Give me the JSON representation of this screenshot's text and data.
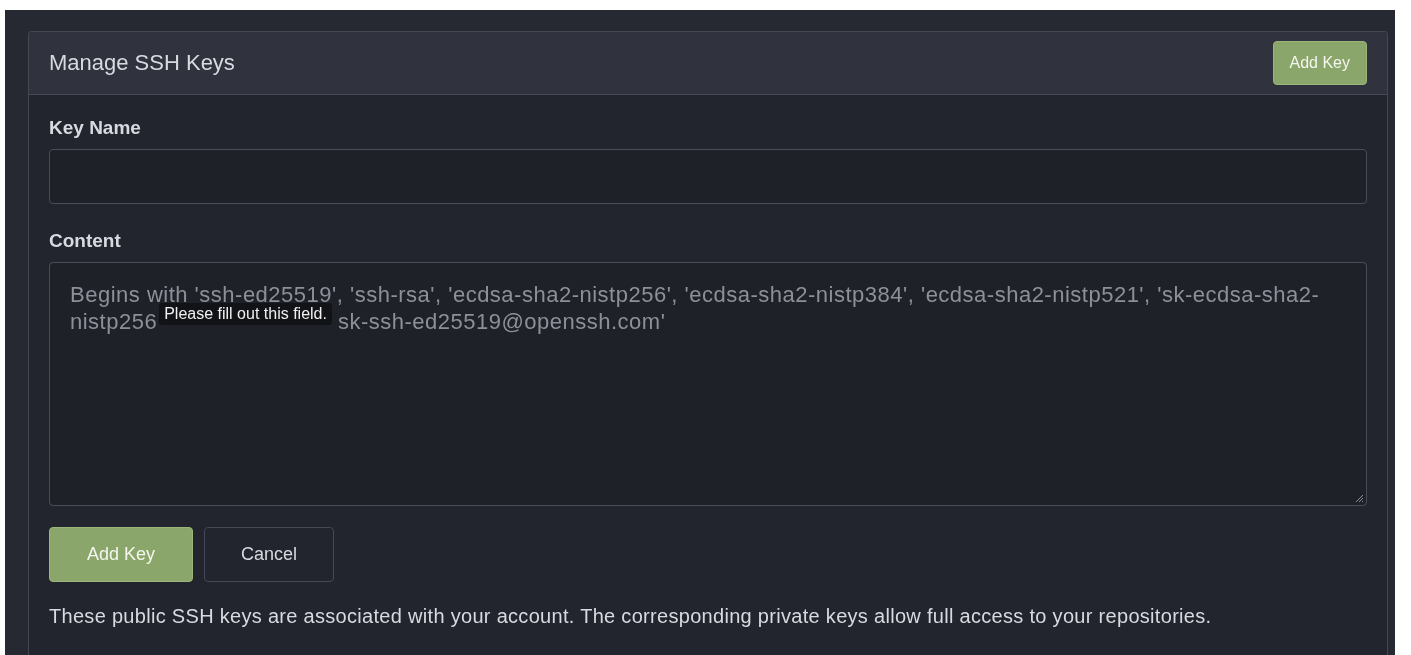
{
  "panel": {
    "title": "Manage SSH Keys",
    "header_button": "Add Key"
  },
  "form": {
    "key_name": {
      "label": "Key Name"
    },
    "content": {
      "label": "Content",
      "placeholder": "Begins with 'ssh-ed25519', 'ssh-rsa', 'ecdsa-sha2-nistp256', 'ecdsa-sha2-nistp384', 'ecdsa-sha2-nistp521', 'sk-ecdsa-sha2-nistp256",
      "placeholder_tail": "sk-ssh-ed25519@openssh.com'"
    },
    "tooltip": "Please fill out this field.",
    "buttons": [
      {
        "label": "Add Key",
        "kind": "primary"
      },
      {
        "label": "Cancel",
        "kind": "secondary"
      }
    ]
  },
  "help_text": "These public SSH keys are associated with your account. The corresponding private keys allow full access to your repositories."
}
